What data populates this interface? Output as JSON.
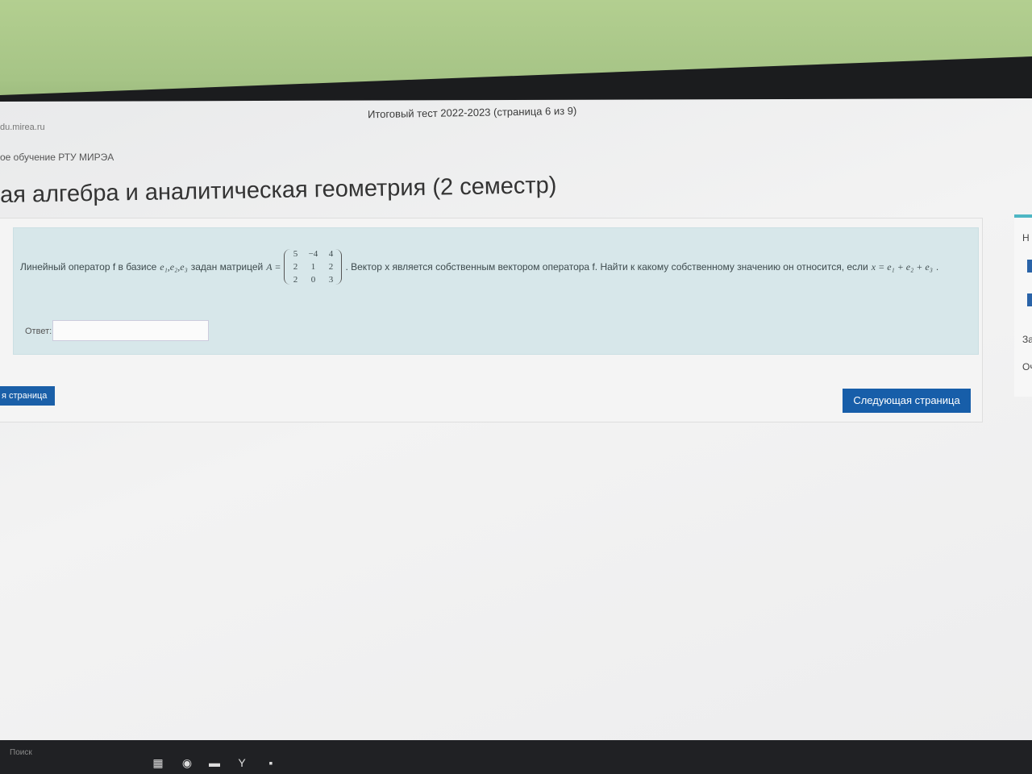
{
  "window_title": "Итоговый тест 2022-2023 (страница 6 из 9)",
  "url": "du.mirea.ru",
  "breadcrumb": "ое обучение РТУ МИРЭА",
  "course_title": "ая алгебра и аналитическая геометрия (2 семестр)",
  "question": {
    "part1": "Линейный оператор f в базисе",
    "basis": "e₁,e₂,e₃",
    "part2": "задан матрицей",
    "matrix_label": "A =",
    "matrix": [
      [
        "5",
        "−4",
        "4"
      ],
      [
        "2",
        "1",
        "2"
      ],
      [
        "2",
        "0",
        "3"
      ]
    ],
    "part3": ". Вектор x является собственным вектором оператора f. Найти к какому собственному значению он относится, если",
    "vector_expr": "x = e₁ + e₂ + e₃",
    "end": "."
  },
  "answer": {
    "label": "Ответ:",
    "value": ""
  },
  "nav": {
    "prev_label": "я страница",
    "next_label": "Следующая страница"
  },
  "side": {
    "item1": "Н",
    "item2": "За",
    "item3": "Оч"
  },
  "taskbar": {
    "search_placeholder": "Поиск"
  },
  "colors": {
    "question_bg": "#d7e7ea",
    "button_blue": "#175ea9",
    "accent_teal": "#4db6c4"
  }
}
